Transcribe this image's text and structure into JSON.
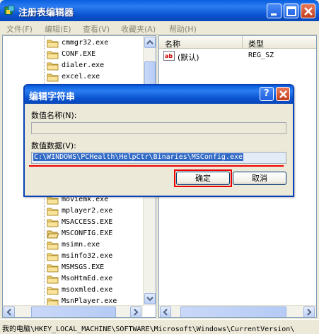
{
  "window": {
    "title": "注册表编辑器"
  },
  "menu": [
    {
      "label": "文件(F)"
    },
    {
      "label": "编辑(E)"
    },
    {
      "label": "查看(V)"
    },
    {
      "label": "收藏夹(A)"
    },
    {
      "label": "帮助(H)"
    }
  ],
  "tree": {
    "items": [
      {
        "label": "cmmgr32.exe"
      },
      {
        "label": "CONF.EXE"
      },
      {
        "label": "dialer.exe"
      },
      {
        "label": "excel.exe"
      },
      {
        "label": "moviemk.exe"
      },
      {
        "label": "mplayer2.exe"
      },
      {
        "label": "MSACCESS.EXE"
      },
      {
        "label": "MSCONFIG.EXE"
      },
      {
        "label": "msimn.exe"
      },
      {
        "label": "msinfo32.exe"
      },
      {
        "label": "MSMSGS.EXE"
      },
      {
        "label": "MsoHtmEd.exe"
      },
      {
        "label": "msoxmled.exe"
      },
      {
        "label": "MsnPlayer.exe"
      }
    ]
  },
  "list": {
    "columns": {
      "name": "名称",
      "type": "类型"
    },
    "rows": [
      {
        "name": "(默认)",
        "type": "REG_SZ"
      }
    ]
  },
  "statusbar": {
    "path": "我的电脑\\HKEY_LOCAL_MACHINE\\SOFTWARE\\Microsoft\\Windows\\CurrentVersion\\"
  },
  "dialog": {
    "title": "编辑字符串",
    "help_label": "?",
    "value_name_label": "数值名称(N):",
    "value_name": "",
    "value_data_label": "数值数据(V):",
    "value_data": "C:\\WINDOWS\\PCHealth\\HelpCtr\\Binaries\\MSConfig.exe",
    "ok_label": "确定",
    "cancel_label": "取消"
  },
  "colors": {
    "titlebar": "#0a5fe0",
    "selection": "#316ac5",
    "annotation": "#e00000"
  }
}
